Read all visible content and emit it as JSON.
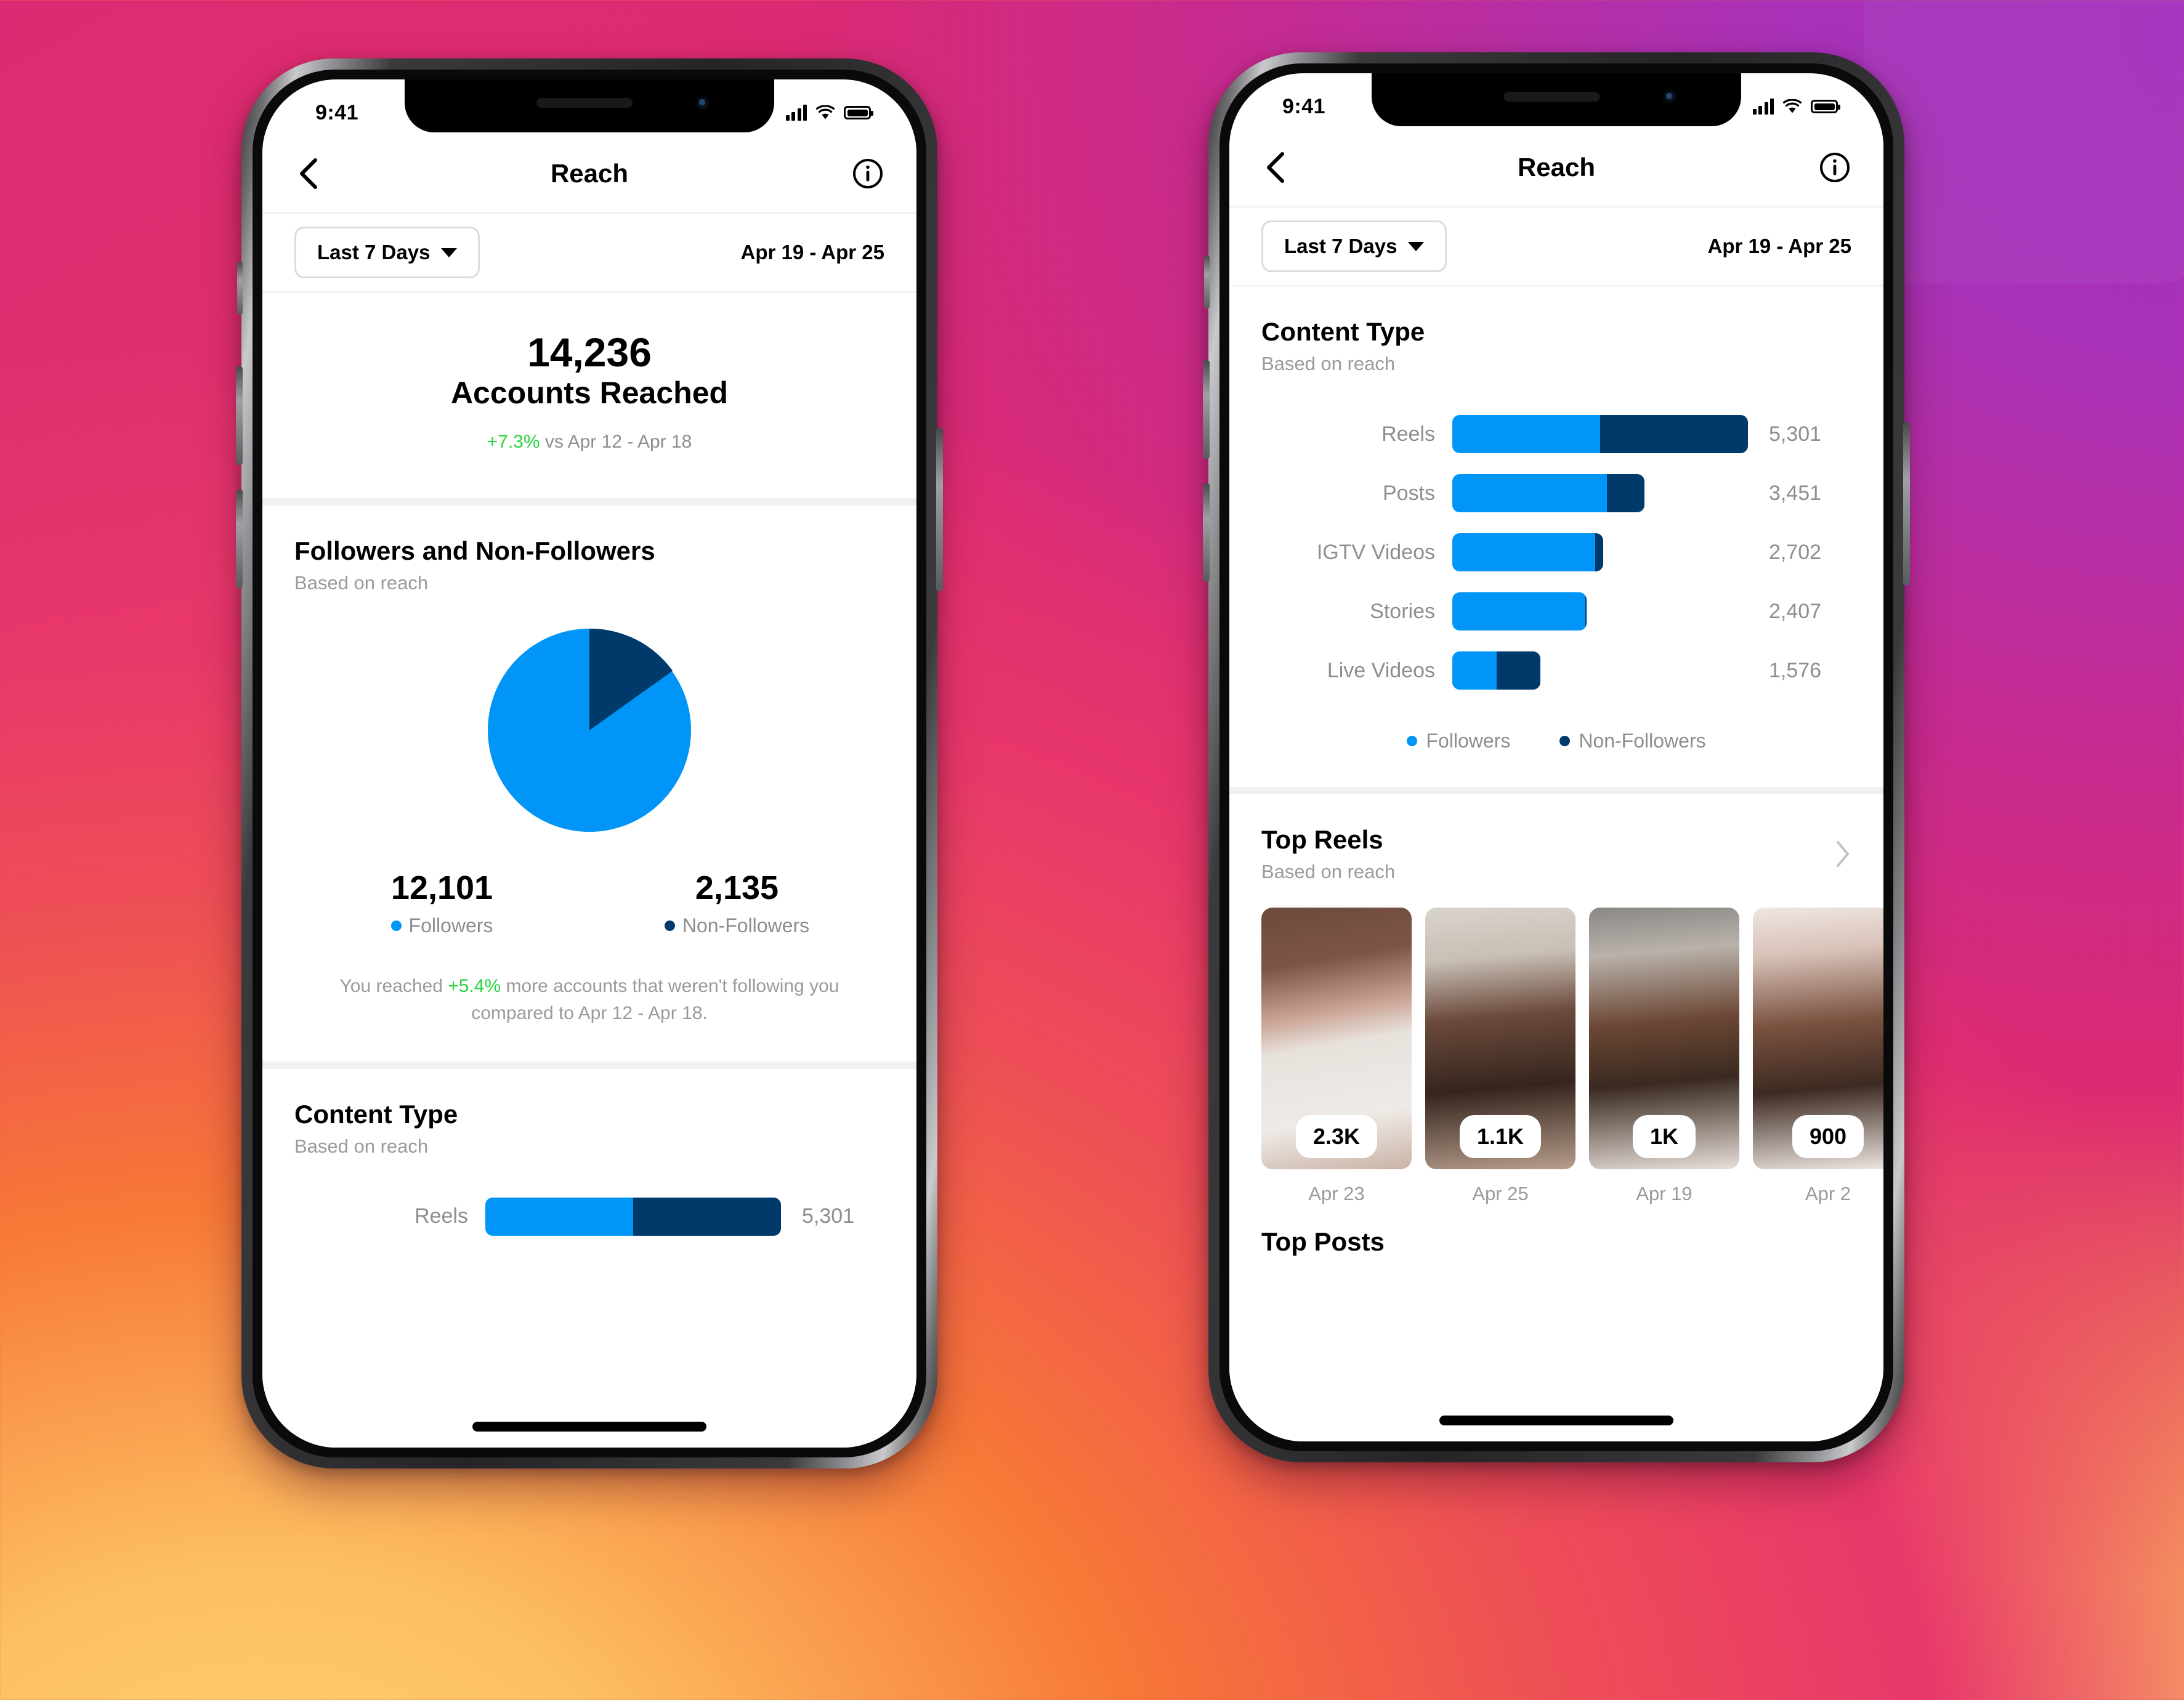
{
  "background": {
    "gradient_colors": [
      "#DD2A72",
      "#A030BE",
      "#EE4E56",
      "#F77737",
      "#FBC163"
    ]
  },
  "colors": {
    "followers": "#0095F6",
    "non_followers": "#003A6B",
    "positive": "#29D440",
    "muted_text": "#8E8E8E"
  },
  "status_bar": {
    "time": "9:41"
  },
  "nav": {
    "title": "Reach",
    "back_icon": "chevron-left-icon",
    "info_icon": "info-circle-icon"
  },
  "filter": {
    "range_chip_label": "Last 7 Days",
    "chip_caret_icon": "chevron-down-icon",
    "date_range": "Apr 19 - Apr 25"
  },
  "phone1": {
    "hero": {
      "value": "14,236",
      "label": "Accounts Reached",
      "delta": "+7.3%",
      "delta_context": "vs Apr 12 - Apr 18"
    },
    "followers_section": {
      "title": "Followers and Non-Followers",
      "subtitle": "Based on reach",
      "followers_value": "12,101",
      "followers_label": "Followers",
      "non_followers_value": "2,135",
      "non_followers_label": "Non-Followers",
      "note_prefix": "You reached ",
      "note_delta": "+5.4%",
      "note_suffix": " more accounts that weren't following you compared to Apr 12 - Apr 18."
    },
    "content_type": {
      "title": "Content Type",
      "subtitle": "Based on reach",
      "first_row_label": "Reels",
      "first_row_value": "5,301"
    }
  },
  "phone2": {
    "content_type": {
      "title": "Content Type",
      "subtitle": "Based on reach",
      "legend": [
        {
          "label": "Followers",
          "color": "#0095F6"
        },
        {
          "label": "Non-Followers",
          "color": "#003A6B"
        }
      ]
    },
    "top_reels": {
      "title": "Top Reels",
      "subtitle": "Based on reach",
      "chevron_icon": "chevron-right-icon",
      "items": [
        {
          "reach": "2.3K",
          "date": "Apr 23",
          "alt": "hand-holding-cleanser-bottle"
        },
        {
          "reach": "1.1K",
          "date": "Apr 25",
          "alt": "woman-long-hair-portrait"
        },
        {
          "reach": "1K",
          "date": "Apr 19",
          "alt": "woman-white-headband-smiling"
        },
        {
          "reach": "900",
          "date": "Apr 2",
          "alt": "woman-pink-headband-smiling"
        }
      ]
    },
    "top_posts": {
      "title": "Top Posts"
    }
  },
  "chart_data": [
    {
      "type": "pie",
      "title": "Followers and Non-Followers",
      "subtitle": "Based on reach",
      "labels": [
        "Followers",
        "Non-Followers"
      ],
      "values": [
        12101,
        2135
      ],
      "percentages": [
        85.0,
        15.0
      ],
      "colors": [
        "#0095F6",
        "#003A6B"
      ],
      "start_angle_deg": 0,
      "legend": "below"
    },
    {
      "type": "bar",
      "orientation": "horizontal",
      "stacked": true,
      "title": "Content Type",
      "subtitle": "Based on reach",
      "categories": [
        "Reels",
        "Posts",
        "IGTV Videos",
        "Stories",
        "Live Videos"
      ],
      "totals": [
        5301,
        3451,
        2702,
        2407,
        1576
      ],
      "value_labels": [
        "5,301",
        "3,451",
        "2,702",
        "2,407",
        "1,576"
      ],
      "series": [
        {
          "name": "Followers",
          "color": "#0095F6",
          "values": [
            2650,
            2770,
            2560,
            2380,
            790
          ]
        },
        {
          "name": "Non-Followers",
          "color": "#003A6B",
          "values": [
            2651,
            681,
            142,
            27,
            786
          ]
        }
      ],
      "max_total": 5301,
      "legend": "bottom",
      "grid": false
    }
  ]
}
